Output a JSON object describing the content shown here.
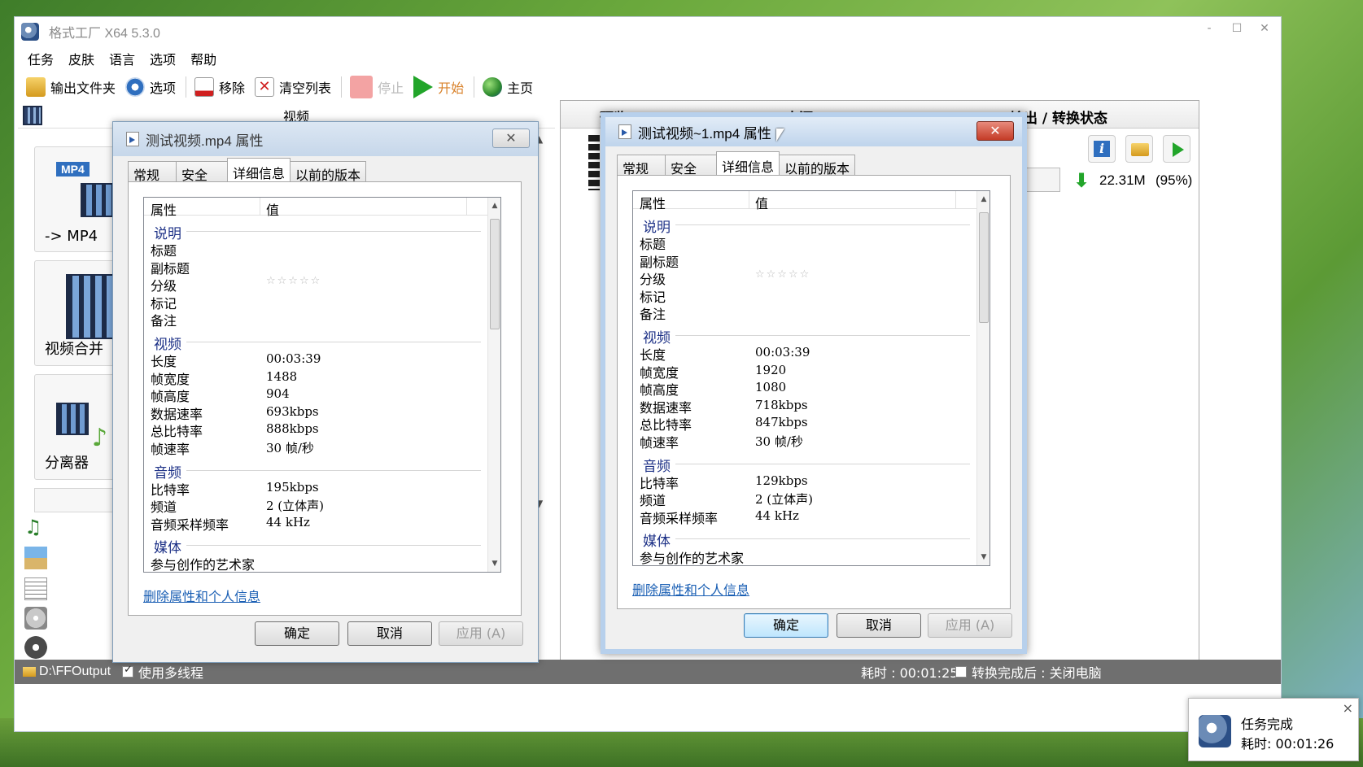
{
  "app": {
    "title": "格式工厂 X64 5.3.0"
  },
  "window_controls": {
    "min": "‐",
    "max": "☐",
    "close": "✕"
  },
  "menu": [
    "任务",
    "皮肤",
    "语言",
    "选项",
    "帮助"
  ],
  "toolbar": {
    "output_folder": "输出文件夹",
    "options": "选项",
    "remove": "移除",
    "clear_list": "清空列表",
    "stop": "停止",
    "start": "开始",
    "home": "主页"
  },
  "left_panel": {
    "header": "视频",
    "tiles": [
      "-> MP4",
      "视频合并",
      "分离器"
    ],
    "mp4_badge": "MP4"
  },
  "list": {
    "headers": [
      "预览",
      "来源",
      "输出 / 转换状态"
    ],
    "row": {
      "size": "22.31M",
      "percent": "(95%)"
    }
  },
  "statusbar": {
    "output_path": "D:\\FFOutput",
    "multithread_label": "使用多线程",
    "elapsed": "耗时 : 00:01:25",
    "after_convert": "转换完成后 : 关闭电脑"
  },
  "dialogs": [
    {
      "title": "测试视频.mp4 属性",
      "tabs": [
        "常规",
        "安全",
        "详细信息",
        "以前的版本"
      ],
      "selected_tab": 2,
      "columns": [
        "属性",
        "值"
      ],
      "groups": [
        {
          "name": "说明",
          "rows": [
            [
              "标题",
              ""
            ],
            [
              "副标题",
              ""
            ],
            [
              "分级",
              "☆☆☆☆☆"
            ],
            [
              "标记",
              ""
            ],
            [
              "备注",
              ""
            ]
          ]
        },
        {
          "name": "视频",
          "rows": [
            [
              "长度",
              "00:03:39"
            ],
            [
              "帧宽度",
              "1488"
            ],
            [
              "帧高度",
              "904"
            ],
            [
              "数据速率",
              "693kbps"
            ],
            [
              "总比特率",
              "888kbps"
            ],
            [
              "帧速率",
              "30 帧/秒"
            ]
          ]
        },
        {
          "name": "音频",
          "rows": [
            [
              "比特率",
              "195kbps"
            ],
            [
              "频道",
              "2 (立体声)"
            ],
            [
              "音频采样频率",
              "44 kHz"
            ]
          ]
        },
        {
          "name": "媒体",
          "rows": [
            [
              "参与创作的艺术家",
              ""
            ]
          ]
        }
      ],
      "remove_link": "删除属性和个人信息",
      "buttons": {
        "ok": "确定",
        "cancel": "取消",
        "apply": "应用 (A)"
      }
    },
    {
      "title": "测试视频~1.mp4 属性",
      "tabs": [
        "常规",
        "安全",
        "详细信息",
        "以前的版本"
      ],
      "selected_tab": 2,
      "columns": [
        "属性",
        "值"
      ],
      "groups": [
        {
          "name": "说明",
          "rows": [
            [
              "标题",
              ""
            ],
            [
              "副标题",
              ""
            ],
            [
              "分级",
              "☆☆☆☆☆"
            ],
            [
              "标记",
              ""
            ],
            [
              "备注",
              ""
            ]
          ]
        },
        {
          "name": "视频",
          "rows": [
            [
              "长度",
              "00:03:39"
            ],
            [
              "帧宽度",
              "1920"
            ],
            [
              "帧高度",
              "1080"
            ],
            [
              "数据速率",
              "718kbps"
            ],
            [
              "总比特率",
              "847kbps"
            ],
            [
              "帧速率",
              "30 帧/秒"
            ]
          ]
        },
        {
          "name": "音频",
          "rows": [
            [
              "比特率",
              "129kbps"
            ],
            [
              "频道",
              "2 (立体声)"
            ],
            [
              "音频采样频率",
              "44 kHz"
            ]
          ]
        },
        {
          "name": "媒体",
          "rows": [
            [
              "参与创作的艺术家",
              ""
            ]
          ]
        }
      ],
      "remove_link": "删除属性和个人信息",
      "buttons": {
        "ok": "确定",
        "cancel": "取消",
        "apply": "应用 (A)"
      }
    }
  ],
  "notification": {
    "title": "任务完成",
    "detail": "耗时: 00:01:26",
    "close": "×"
  },
  "colors": {
    "start_green": "#22a52a",
    "link_blue": "#1a5fb4",
    "group_blue": "#1e3287",
    "close_red": "#c43b26"
  }
}
